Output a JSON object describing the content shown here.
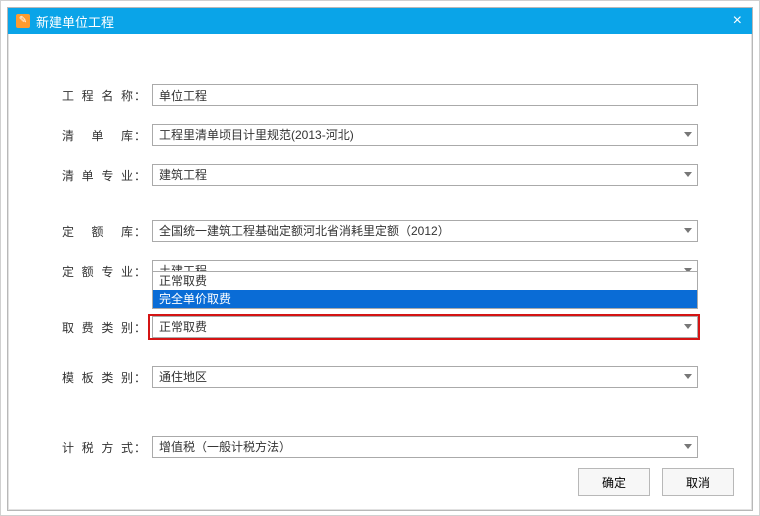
{
  "title": "新建单位工程",
  "labels": {
    "project_name": "工程名称",
    "qd_lib": "清 单 库",
    "qd_spec": "清单专业",
    "de_lib": "定 额 库",
    "de_spec": "定额专业",
    "fee_type": "取费类别",
    "tpl_type": "模板类别",
    "tax_method": "计税方式",
    "colon": "："
  },
  "values": {
    "project_name": "单位工程",
    "qd_lib": "工程里清单顷目计里规范(2013-河北)",
    "qd_spec": "建筑工程",
    "de_lib": "全国统一建筑工程基础定额河北省消耗里定额（2012）",
    "de_spec": "土建工程",
    "fee_type": "正常取费",
    "tpl_type": "通住地区",
    "tax_method": "增值税（一般计税方法）"
  },
  "dropdown": {
    "options": [
      "正常取费",
      "完全单价取费"
    ],
    "selected_index": 1
  },
  "buttons": {
    "ok": "确定",
    "cancel": "取消"
  }
}
